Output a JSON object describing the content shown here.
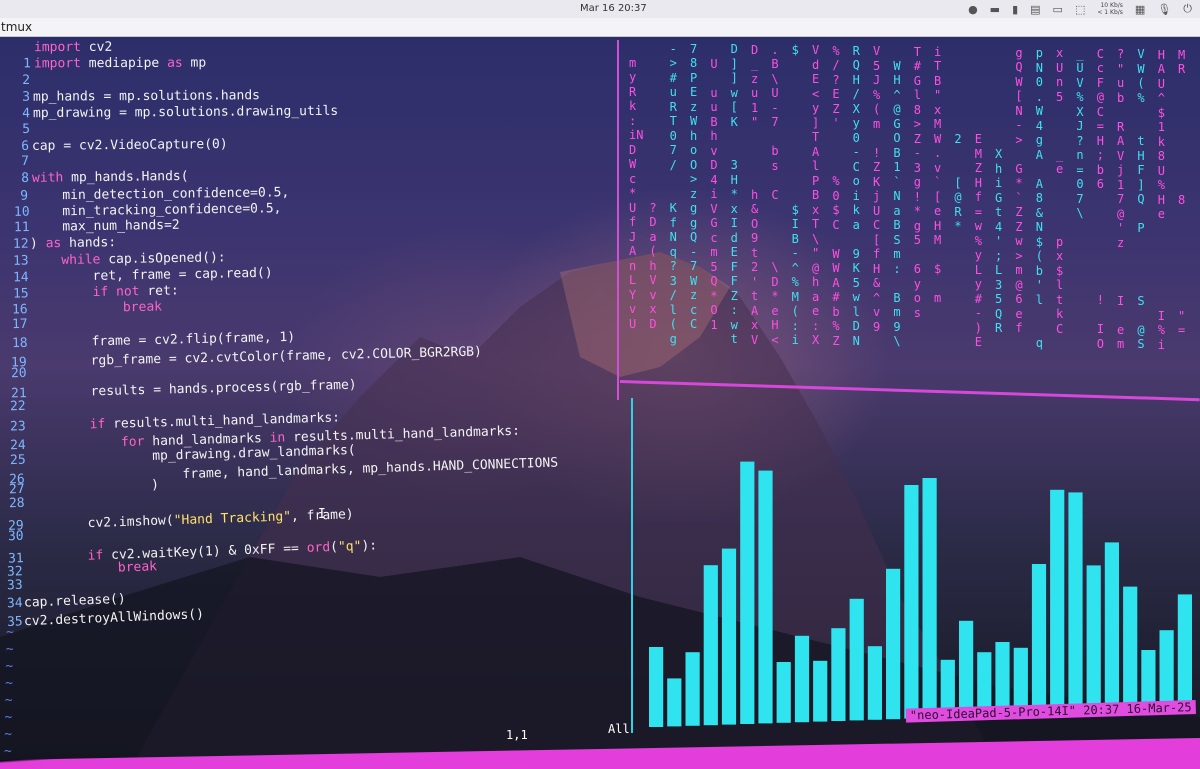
{
  "topbar": {
    "datetime": "Mar 16  20:37",
    "net_up": "10 Kb/s",
    "net_down": "< 1 Kb/s"
  },
  "window": {
    "title": "tmux"
  },
  "editor": {
    "lines": [
      {
        "n": "",
        "parts": [
          [
            "kw",
            "import"
          ],
          [
            "t",
            " cv2"
          ]
        ]
      },
      {
        "n": "1",
        "parts": [
          [
            "kw",
            "import"
          ],
          [
            "t",
            " mediapipe "
          ],
          [
            "kw",
            "as"
          ],
          [
            "t",
            " mp"
          ]
        ]
      },
      {
        "n": "2",
        "parts": []
      },
      {
        "n": "3",
        "parts": [
          [
            "t",
            "mp_hands = mp.solutions.hands"
          ]
        ]
      },
      {
        "n": "4",
        "parts": [
          [
            "t",
            "mp_drawing = mp.solutions.drawing_utils"
          ]
        ]
      },
      {
        "n": "5",
        "parts": []
      },
      {
        "n": "6",
        "parts": [
          [
            "t",
            "cap = cv2.VideoCapture(0)"
          ]
        ]
      },
      {
        "n": "7",
        "parts": []
      },
      {
        "n": "8",
        "parts": [
          [
            "kw",
            "with"
          ],
          [
            "t",
            " mp_hands.Hands("
          ]
        ]
      },
      {
        "n": "9",
        "parts": [
          [
            "t",
            "    min_detection_confidence=0.5,"
          ]
        ]
      },
      {
        "n": "10",
        "parts": [
          [
            "t",
            "    min_tracking_confidence=0.5,"
          ]
        ]
      },
      {
        "n": "11",
        "parts": [
          [
            "t",
            "    max_num_hands=2"
          ]
        ]
      },
      {
        "n": "12",
        "parts": [
          [
            "t",
            ") "
          ],
          [
            "kw",
            "as"
          ],
          [
            "t",
            " hands:"
          ]
        ]
      },
      {
        "n": "13",
        "parts": [
          [
            "t",
            "    "
          ],
          [
            "kw",
            "while"
          ],
          [
            "t",
            " cap.isOpened():"
          ]
        ]
      },
      {
        "n": "14",
        "parts": [
          [
            "t",
            "        ret, frame = cap.read()"
          ]
        ]
      },
      {
        "n": "15",
        "parts": [
          [
            "t",
            "        "
          ],
          [
            "kw",
            "if not"
          ],
          [
            "t",
            " ret:"
          ]
        ]
      },
      {
        "n": "16",
        "parts": [
          [
            "t",
            "            "
          ],
          [
            "kw",
            "break"
          ]
        ]
      },
      {
        "n": "17",
        "parts": []
      },
      {
        "n": "18",
        "parts": [
          [
            "t",
            "        frame = cv2.flip(frame, 1)"
          ]
        ]
      },
      {
        "n": "19",
        "parts": [
          [
            "t",
            "        rgb_frame = cv2.cvtColor(frame, cv2.COLOR_BGR2RGB)"
          ]
        ]
      },
      {
        "n": "20",
        "parts": []
      },
      {
        "n": "21",
        "parts": [
          [
            "t",
            "        results = hands.process(rgb_frame)"
          ]
        ]
      },
      {
        "n": "22",
        "parts": []
      },
      {
        "n": "23",
        "parts": [
          [
            "t",
            "        "
          ],
          [
            "kw",
            "if"
          ],
          [
            "t",
            " results.multi_hand_landmarks:"
          ]
        ]
      },
      {
        "n": "24",
        "parts": [
          [
            "t",
            "            "
          ],
          [
            "kw",
            "for"
          ],
          [
            "t",
            " hand_landmarks "
          ],
          [
            "kw",
            "in"
          ],
          [
            "t",
            " results.multi_hand_landmarks:"
          ]
        ]
      },
      {
        "n": "25",
        "parts": [
          [
            "t",
            "                mp_drawing.draw_landmarks("
          ]
        ]
      },
      {
        "n": "26",
        "parts": [
          [
            "t",
            "                    frame, hand_landmarks, mp_hands.HAND_CONNECTIONS"
          ]
        ]
      },
      {
        "n": "27",
        "parts": [
          [
            "t",
            "                )"
          ]
        ]
      },
      {
        "n": "28",
        "parts": []
      },
      {
        "n": "29",
        "parts": [
          [
            "t",
            "        cv2.imshow("
          ],
          [
            "str",
            "\"Hand Tracking\""
          ],
          [
            "t",
            ", frame)"
          ]
        ]
      },
      {
        "n": "30",
        "parts": []
      },
      {
        "n": "31",
        "parts": [
          [
            "t",
            "        "
          ],
          [
            "kw",
            "if"
          ],
          [
            "t",
            " cv2.waitKey(1) & 0xFF == "
          ],
          [
            "kw",
            "ord"
          ],
          [
            "t",
            "("
          ],
          [
            "str",
            "\"q\""
          ],
          [
            "t",
            "):"
          ]
        ]
      },
      {
        "n": "32",
        "parts": [
          [
            "t",
            "            "
          ],
          [
            "kw",
            "break"
          ]
        ]
      },
      {
        "n": "33",
        "parts": []
      },
      {
        "n": "34",
        "parts": [
          [
            "t",
            "cap.release()"
          ]
        ]
      },
      {
        "n": "35",
        "parts": [
          [
            "t",
            "cv2.destroyAllWindows()"
          ]
        ]
      }
    ],
    "cursor_pos": "1,1",
    "scroll": "All"
  },
  "matrix": {
    "colors": {
      "magenta": "#ff4fe0",
      "cyan": "#3fe0f0"
    },
    "columns": [
      {
        "c": "magenta",
        "t": "\nm\ny\nR\nk\n:\niN\nD\nW\nc\n*\nU\nf\nJ\nA\nn\nL\nY\nv\nU"
      },
      {
        "c": "magenta",
        "t": "\n\n\n\n\n\n\n\n\n\n\n?\nD\na\n(\nh\nV\nv\nx\nD"
      },
      {
        "c": "cyan",
        "t": "-\n>\n#\nu\nR\nT\n0\n7\n/\n\n\nK\nf\nN\nq\n?\n3\n/\nl\n(\ng"
      },
      {
        "c": "cyan",
        "t": "7\n8\nP\nE\nz\nW\nh\no\nO\n>\nz\ng\ng\nQ\n-\n7\nW\nz\nc\nC\n"
      },
      {
        "c": "magenta",
        "t": "\nU\n\nu\nu\nB\nh\nv\nD\n4\ni\nV\nG\nc\nm\n5\nQ\n*\nO\n1\n"
      },
      {
        "c": "cyan",
        "t": "D\n]\n]\nw\n[\nK\n\n\n3\nH\n*\nx\nI\nd\nE\nF\nF\nZ\n:\nw\nt"
      },
      {
        "c": "magenta",
        "t": "D\n_\nz\nu\n1\n\"\n\n\n\n\nh\n&\nO\n9\nt\n2\n'\nt\nA\nx\nV"
      },
      {
        "c": "magenta",
        "t": ".\nB\n\\\nU\n-\n7\n\nb\ns\n\nC\n\n\n\n\n\\\nD\n*\ne\nH\n<"
      },
      {
        "c": "cyan",
        "t": "$\n\n\n\n\n\n\n\n\n\n\n$\nI\nB\n-\n^\n%\nM\n(\n:\ni"
      },
      {
        "c": "magenta",
        "t": "V\nd\nE\n<\ny\n]\nT\nA\nl\nP\nB\nx\nT\n\\\n\"\n@\nh\na\ne\n:\nX"
      },
      {
        "c": "magenta",
        "t": "%\n/\n?\nE\nZ\n'\n\n\n\n%\n0\n$\nC\n\nW\nW\nA\n#\nb\n%\nZ"
      },
      {
        "c": "cyan",
        "t": "R\nQ\nH\n/\nX\ny\n0\n-\nC\no\ni\nk\na\n\n9\nK\n5\nw\nl\nD\nN"
      },
      {
        "c": "magenta",
        "t": "V\n5\nJ\n%\n(\nm\n\n!\nZ\nK\nj\nU\nC\n[\nf\nH\n&\n^\nv\n9\n"
      },
      {
        "c": "cyan",
        "t": "\nW\nH\n^\n@\nG\nO\nB\n1\n`\nN\na\nB\nS\nm\n:\n\nB\nm\n9\n\\"
      },
      {
        "c": "magenta",
        "t": "T\n#\nG\nl\n8\n>\nZ\n-\n3\ng\n!\n*\ng\n5\n\n6\ny\no\ns\n"
      },
      {
        "c": "magenta",
        "t": "i\nT\nB\n\"\nx\nM\nW\n.\nv\n`\n[\ne\nH\nM\n\n$\n\nm\n\n"
      },
      {
        "c": "cyan",
        "t": "\n\n\n\n\n\n2\n\n\n[\n@\nR\n*\n\n\n\n\n\n\n"
      },
      {
        "c": "magenta",
        "t": "\n\n\n\n\n\nE\nM\nZ\nH\nf\n=\nw\n%\ny\nL\ny\n#\n-\n)\nE"
      },
      {
        "c": "cyan",
        "t": "\n\n\n\n\n\n\nX\nh\ni\nG\nt\n4\n'\n;\nL\n3\n5\nQ\nR\n"
      },
      {
        "c": "magenta",
        "t": "g\nQ\nW\n[\nN\n-\n>\n\nG\n*\n`\nZ\nZ\nw\n>\nm\n@\n6\ne\nf\n"
      },
      {
        "c": "cyan",
        "t": "p\nN\n0\n.\nW\n4\ng\nA\n\nA\n8\n&\nN\n$\n(\nb\n'\nl\n\n\nq"
      },
      {
        "c": "magenta",
        "t": "x\nU\nn\n5\n\n\n\n_\ne\n\n\n\n\np\nx\n$\nl\nt\nk\nC\n"
      },
      {
        "c": "cyan",
        "t": "_\nU\nV\n%\nX\nJ\n?\nn\n=\n0\n7\n\\\n\n\n\n\n\n\n\n\n"
      },
      {
        "c": "magenta",
        "t": "C\nc\nF\n@\nC\n=\nH\n;\nb\n6\n\n\n\n\n\n\n\n!\n\nI\nO"
      },
      {
        "c": "magenta",
        "t": "?\n\"\nu\nb\n\nR\nA\nV\nj\n1\n7\n@\n'\nz\n\n\n\nI\n\ne\nm"
      },
      {
        "c": "cyan",
        "t": "V\nW\n(\n%\n\n\nt\nH\nF\n]\nQ\n\nP\n\n\n\n\nS\n\n@\nS"
      },
      {
        "c": "magenta",
        "t": "H\nA\nU\n^\n$\n1\nk\n8\nU\n%\nH\ne\n\n\n\n\n\n\nI\n%\ni"
      },
      {
        "c": "magenta",
        "t": "M\nR\n\n\n\n\n\n\n\n\n8\n\n\n\n\n\n\n\n\"\n="
      }
    ]
  },
  "visualizer": {
    "color": "#2fe3ef",
    "chart_data": {
      "type": "bar",
      "title": "",
      "values": [
        0.25,
        0.15,
        0.23,
        0.5,
        0.55,
        0.82,
        0.79,
        0.19,
        0.27,
        0.19,
        0.29,
        0.38,
        0.23,
        0.47,
        0.73,
        0.75,
        0.18,
        0.3,
        0.2,
        0.23,
        0.21,
        0.47,
        0.7,
        0.69,
        0.46,
        0.53,
        0.39,
        0.19,
        0.25,
        0.36
      ]
    }
  },
  "tmux": {
    "right_status": "\"neo-IdeaPad-5-Pro-14I\" 20:37 16-Mar-25"
  }
}
